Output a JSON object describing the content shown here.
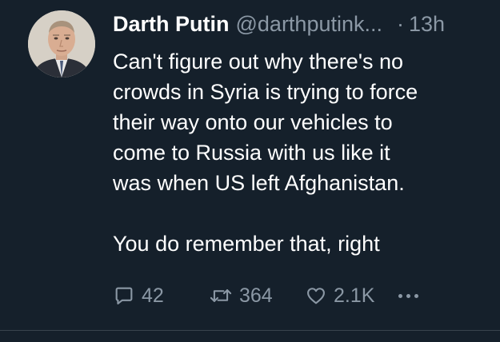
{
  "tweet": {
    "author": {
      "display_name": "Darth Putin",
      "handle": "@darthputink...",
      "avatar_icon": "profile-photo"
    },
    "separator": "·",
    "timestamp": "13h",
    "text": {
      "paragraph_1_lines": [
        "Can't figure out why there's no",
        "crowds in Syria is trying to force",
        "their way onto our vehicles to",
        "come to Russia with us like it",
        "was when US left Afghanistan."
      ],
      "paragraph_2": "You do remember that, right"
    },
    "actions": {
      "reply": {
        "icon": "reply-icon",
        "count": "42"
      },
      "retweet": {
        "icon": "retweet-icon",
        "count": "364"
      },
      "like": {
        "icon": "heart-icon",
        "count": "2.1K"
      },
      "more": {
        "icon": "more-dots-icon"
      }
    }
  },
  "colors": {
    "background": "#15202b",
    "primary_text": "#ffffff",
    "secondary_text": "#8b98a5",
    "divider": "#38444d"
  }
}
